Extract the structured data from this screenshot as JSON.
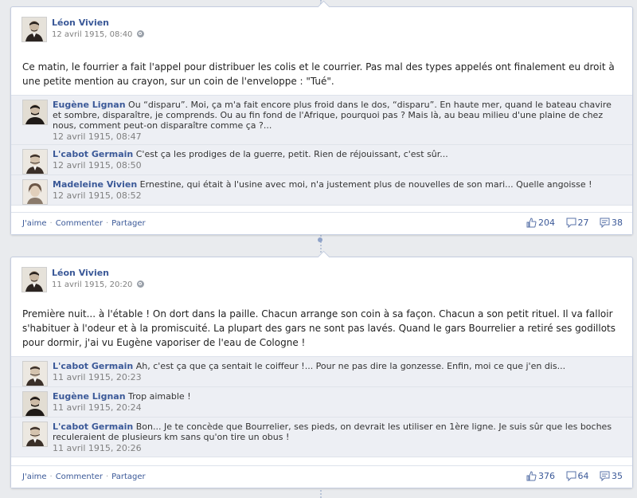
{
  "posts": [
    {
      "author": "Léon Vivien",
      "date": "12 avril 1915, 08:40",
      "text": "Ce matin, le fourrier a fait l'appel pour distribuer les colis et le courrier. Pas mal des types appelés ont finalement eu droit à une petite mention au crayon, sur un coin de l'enveloppe : \"Tué\".",
      "comments": [
        {
          "author": "Eugène Lignan",
          "text": "Ou “disparu”. Moi, ça m'a fait encore plus froid dans le dos, “disparu”. En haute mer, quand le bateau chavire et sombre, disparaître, je comprends. Ou au fin fond de l'Afrique, pourquoi pas ? Mais là, au beau milieu d'une plaine de chez nous, comment peut-on disparaître comme ça ?...",
          "time": "12 avril 1915, 08:47"
        },
        {
          "author": "L'cabot Germain",
          "text": "C'est ça les prodiges de la guerre, petit. Rien de réjouissant, c'est sûr...",
          "time": "12 avril 1915, 08:50"
        },
        {
          "author": "Madeleine Vivien",
          "text": "Ernestine, qui était à l'usine avec moi, n'a justement plus de nouvelles de son mari... Quelle angoisse !",
          "time": "12 avril 1915, 08:52"
        }
      ],
      "actions": {
        "like": "J'aime",
        "comment": "Commenter",
        "share": "Partager"
      },
      "stats": {
        "likes": "204",
        "comments": "27",
        "shares": "38"
      }
    },
    {
      "author": "Léon Vivien",
      "date": "11 avril 1915, 20:20",
      "text": "Première nuit... à l'étable ! On dort dans la paille. Chacun arrange son coin à sa façon. Chacun a son petit rituel. Il va falloir s'habituer à l'odeur et à la promiscuité. La plupart des gars ne sont pas lavés. Quand le gars Bourrelier a retiré ses godillots pour dormir, j'ai vu Eugène vaporiser de l'eau de Cologne !",
      "comments": [
        {
          "author": "L'cabot Germain",
          "text": "Ah, c'est ça que ça sentait le coiffeur !... Pour ne pas dire la gonzesse. Enfin, moi ce que j'en dis...",
          "time": "11 avril 1915, 20:23"
        },
        {
          "author": "Eugène Lignan",
          "text": "Trop aimable !",
          "time": "11 avril 1915, 20:24"
        },
        {
          "author": "L'cabot Germain",
          "text": "Bon... Je te concède que Bourrelier, ses pieds, on devrait les utiliser en 1ère ligne. Je suis sûr que les boches reculeraient de plusieurs km sans qu'on tire un obus !",
          "time": "11 avril 1915, 20:26"
        }
      ],
      "actions": {
        "like": "J'aime",
        "comment": "Commenter",
        "share": "Partager"
      },
      "stats": {
        "likes": "376",
        "comments": "64",
        "shares": "35"
      }
    }
  ],
  "colors": {
    "link": "#3b5998",
    "background": "#e9ebee",
    "comment_bg": "#edeff4"
  }
}
